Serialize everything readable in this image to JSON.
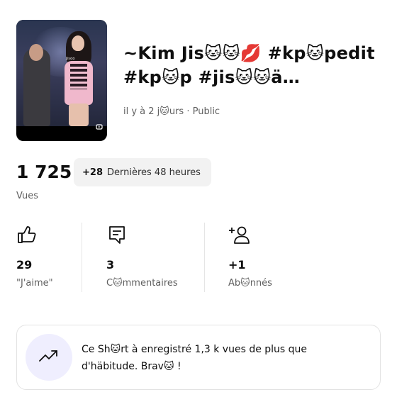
{
  "video": {
    "thumbnail_tiny_text": "Jisoo",
    "title": "~Kim Jis🐱🐱💋 #kp🐱pedit #kp🐱p #jis🐱🐱ä #bläckp…",
    "meta": "il y à 2 j🐱urs · Public"
  },
  "views": {
    "count": "1 725",
    "recent_delta": "+28",
    "recent_label": "Dernières 48 heures",
    "label": "Vues"
  },
  "stats": [
    {
      "icon": "thumbs-up-icon",
      "value": "29",
      "label": "\"J'aime\""
    },
    {
      "icon": "comment-icon",
      "value": "3",
      "label": "C🐱mmentaires"
    },
    {
      "icon": "add-subscriber-icon",
      "value": "+1",
      "label": "Ab🐱nnés"
    }
  ],
  "insight": {
    "icon": "trending-up-icon",
    "message": "Ce Sh🐱rt à enregistré 1,3 k vues de plus que d'häbitude. Brav🐱 !"
  },
  "colors": {
    "accent_bubble": "#efeefe",
    "chip_bg": "#f2f2f2",
    "secondary_text": "#606060"
  }
}
